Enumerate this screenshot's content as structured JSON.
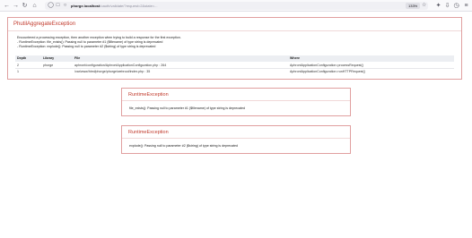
{
  "browser": {
    "url_host": "phorge.localhost",
    "url_path": "/oauth/validate/?request=2&state=...",
    "zoom": "133%"
  },
  "main_exception": {
    "title": "PhutilAggregateException",
    "message_lines": [
      "Encountered a processing exception, then another exception when trying to build a response for the first exception.",
      "- RuntimeException: file_exists(): Passing null to parameter #1 ($filename) of type string is deprecated",
      "- RuntimeException: explode(): Passing null to parameter #2 ($string) of type string is deprecated"
    ],
    "trace_columns": [
      "Depth",
      "Library",
      "File",
      "Where"
    ],
    "trace_rows": [
      {
        "depth": "2",
        "library": "phorge",
        "file": "aphront/configuration/AphrontApplicationConfiguration.php : 264",
        "where": "AphrontApplicationConfiguration::processRequest()"
      },
      {
        "depth": "1",
        "library": "",
        "file": "/var/www/html/phorge/phorge/webroot/index.php : 35",
        "where": "AphrontApplicationConfiguration::runHTTPRequest()"
      }
    ]
  },
  "sub_exceptions": [
    {
      "title": "RuntimeException",
      "message": "file_exists(): Passing null to parameter #1 ($filename) of type string is deprecated"
    },
    {
      "title": "RuntimeException",
      "message": "explode(): Passing null to parameter #2 ($string) of type string is deprecated"
    }
  ]
}
